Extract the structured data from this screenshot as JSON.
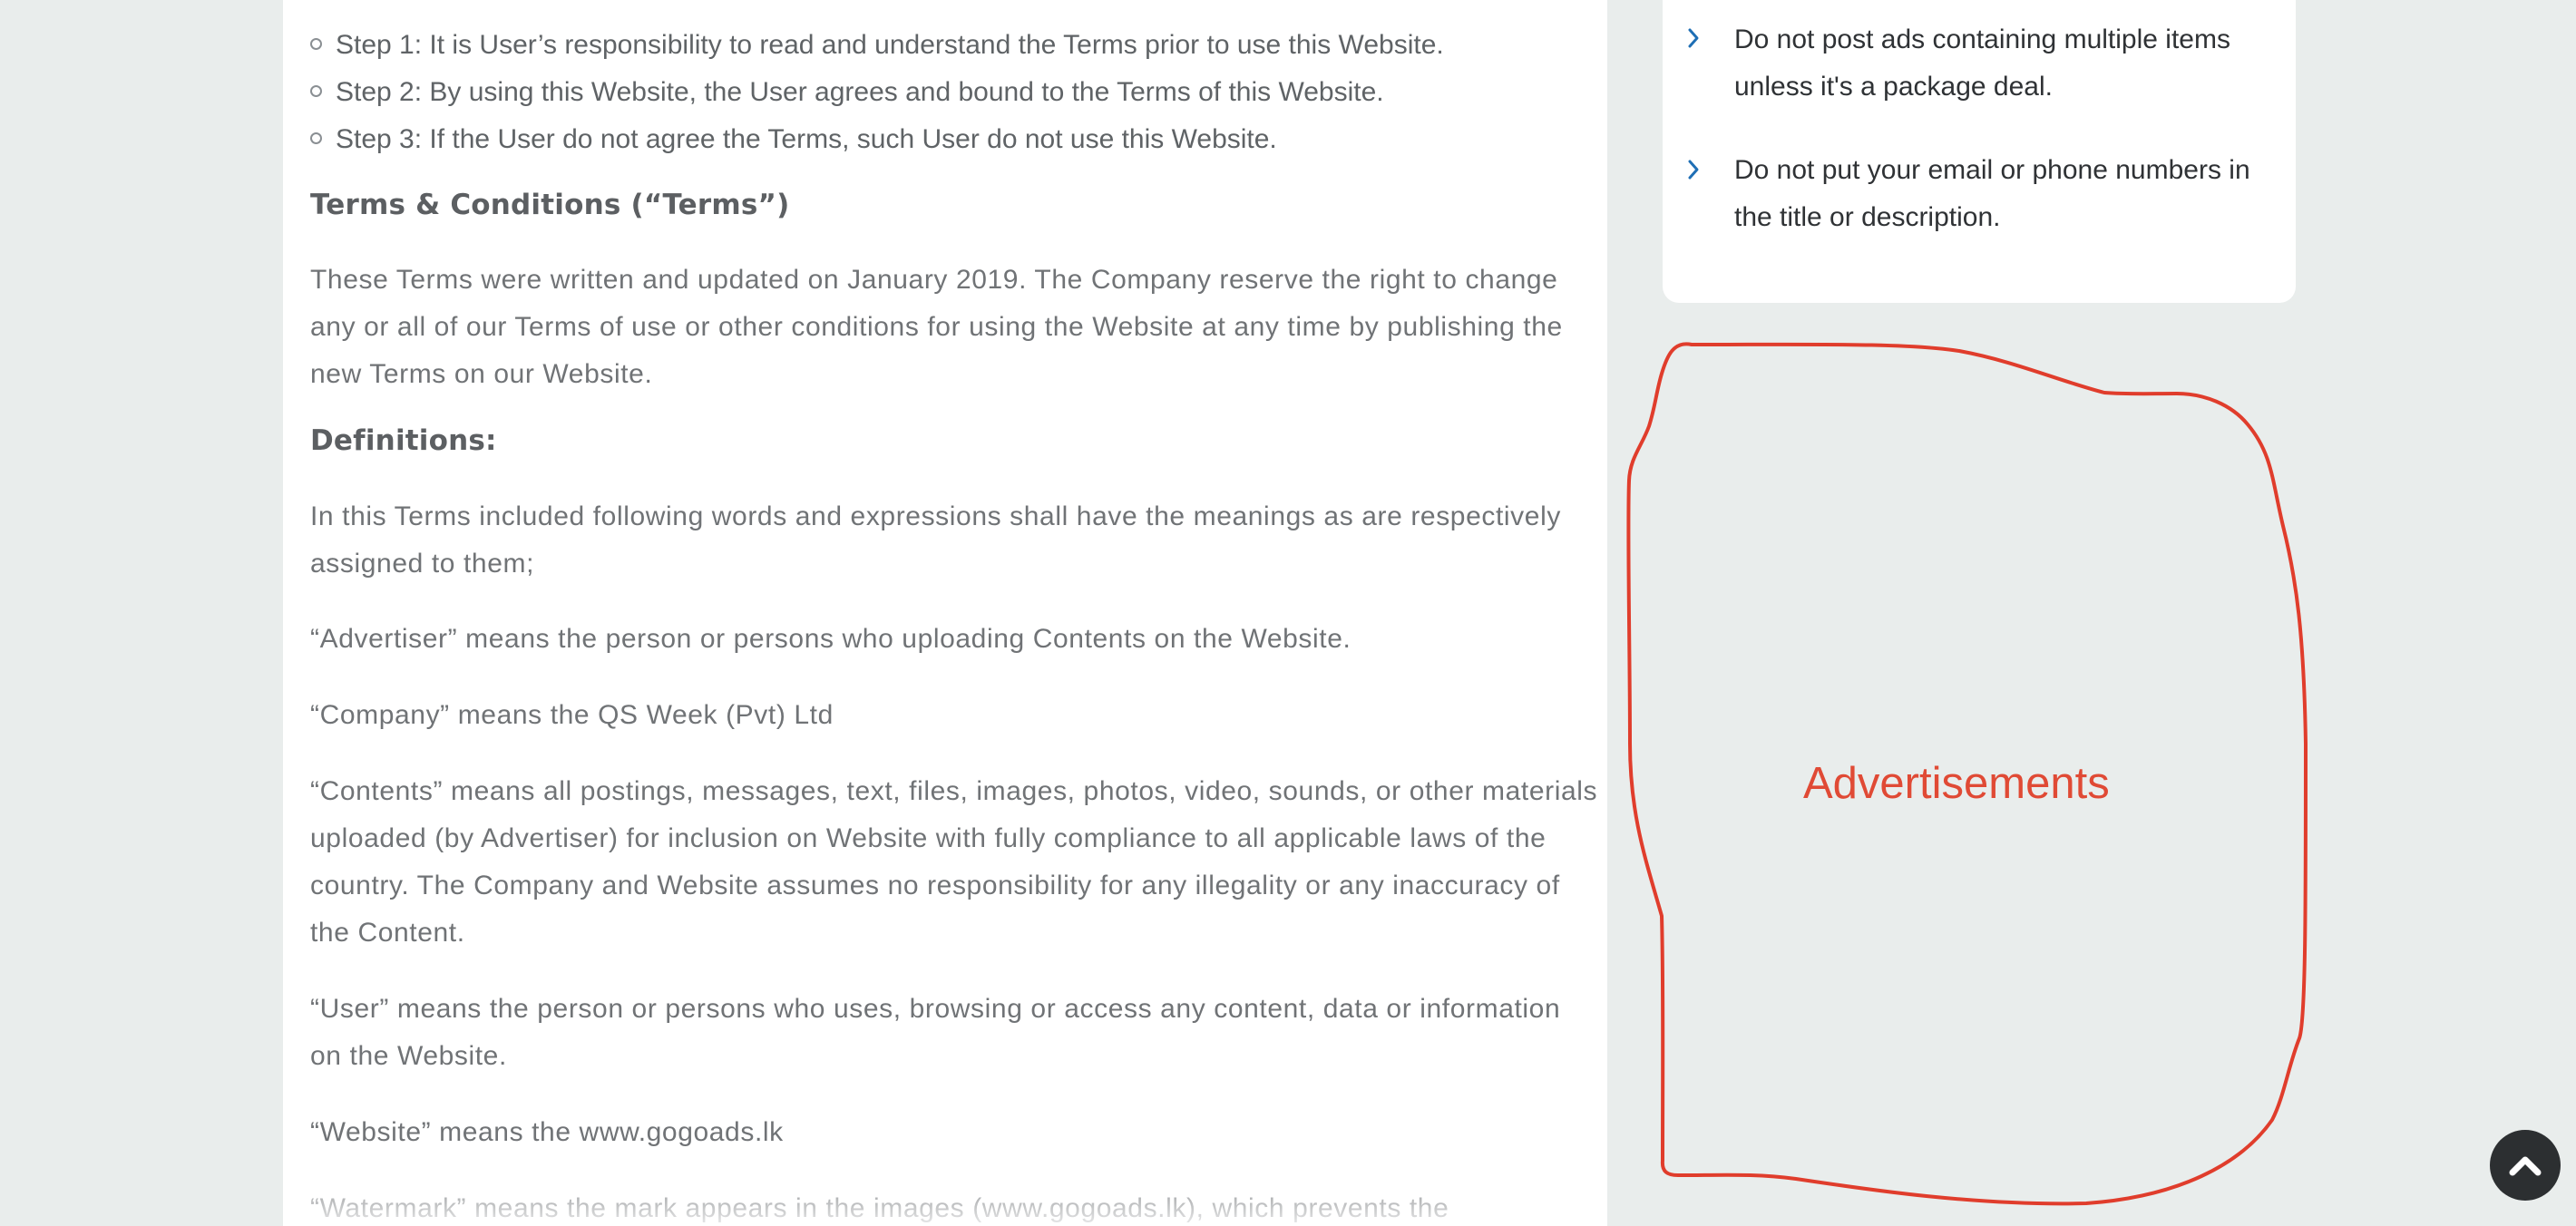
{
  "terms": {
    "steps": [
      "Step 1: It is User’s responsibility to read and understand the Terms prior to use this Website.",
      "Step 2: By using this Website, the User agrees and bound to the Terms of this Website.",
      "Step 3: If the User do not agree the Terms, such User do not use this Website."
    ],
    "heading": "Terms & Conditions (“Terms”)",
    "intro": "These Terms were written and updated on January 2019. The Company reserve the right to change any or all of our Terms of use or other conditions for using the Website at any time by publishing the new Terms on our Website.",
    "definitions_heading": "Definitions:",
    "definitions_intro": "In this Terms included following words and expressions shall have the meanings as are respectively assigned to them;",
    "definitions": [
      "“Advertiser” means the person or persons who uploading Contents on the Website.",
      "“Company” means the QS Week (Pvt) Ltd",
      "“Contents” means all postings, messages, text, files, images, photos, video, sounds, or other materials uploaded (by Advertiser) for inclusion on Website with fully compliance to all applicable laws of the country. The Company and Website assumes no responsibility for any illegality or any inaccuracy of the Content.",
      "“User” means the person or persons who uses, browsing or access any content, data or information on the Website.",
      "“Website” means the www.gogoads.lk",
      "“Watermark” means the mark appears in the images (www.gogoads.lk), which prevents the"
    ]
  },
  "sidebar": {
    "tips": [
      "Do not post ads containing multiple items unless it's a package deal.",
      "Do not put your email or phone numbers in the title or description."
    ],
    "ad_label": "Advertisements"
  },
  "colors": {
    "accent": "#1f6fb5",
    "annotation": "#e04a35"
  },
  "icons": {
    "bullet": "circle-bullet-icon",
    "tip": "chevron-right-icon",
    "scroll": "chevron-up-icon"
  }
}
